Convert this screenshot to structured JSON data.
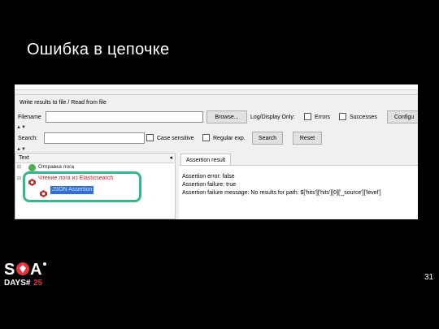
{
  "slide": {
    "title": "Ошибка в цепочке",
    "page_number": "31"
  },
  "logo": {
    "line1": "SQA",
    "line2": "DAYS#25"
  },
  "panel": {
    "title": "Write results to file / Read from file",
    "filename_label": "Filename",
    "filename_value": "",
    "browse_label": "Browse...",
    "log_display_label": "Log/Display Only:",
    "errors_label": "Errors",
    "successes_label": "Successes",
    "configure_label": "Configu"
  },
  "search": {
    "label": "Search:",
    "value": "",
    "case_sensitive_label": "Case sensitive",
    "regex_label": "Regular exp.",
    "search_button": "Search",
    "reset_button": "Reset"
  },
  "tree": {
    "header": "Text",
    "items": [
      {
        "label": "Отправка лога"
      },
      {
        "label": "Чтение лога из Elasticsearch"
      },
      {
        "label": "JSON Assertion"
      }
    ]
  },
  "result": {
    "tab_label": "Assertion result",
    "lines": [
      "Assertion error: false",
      "Assertion failure: true",
      "Assertion failure message: No results for path: $['hits']['hits'][0]['_source']['level']"
    ]
  },
  "colors": {
    "highlight": "#38b78f",
    "error_text": "#e02020",
    "selection": "#2f6fd6",
    "brand_red": "#e8323c"
  }
}
